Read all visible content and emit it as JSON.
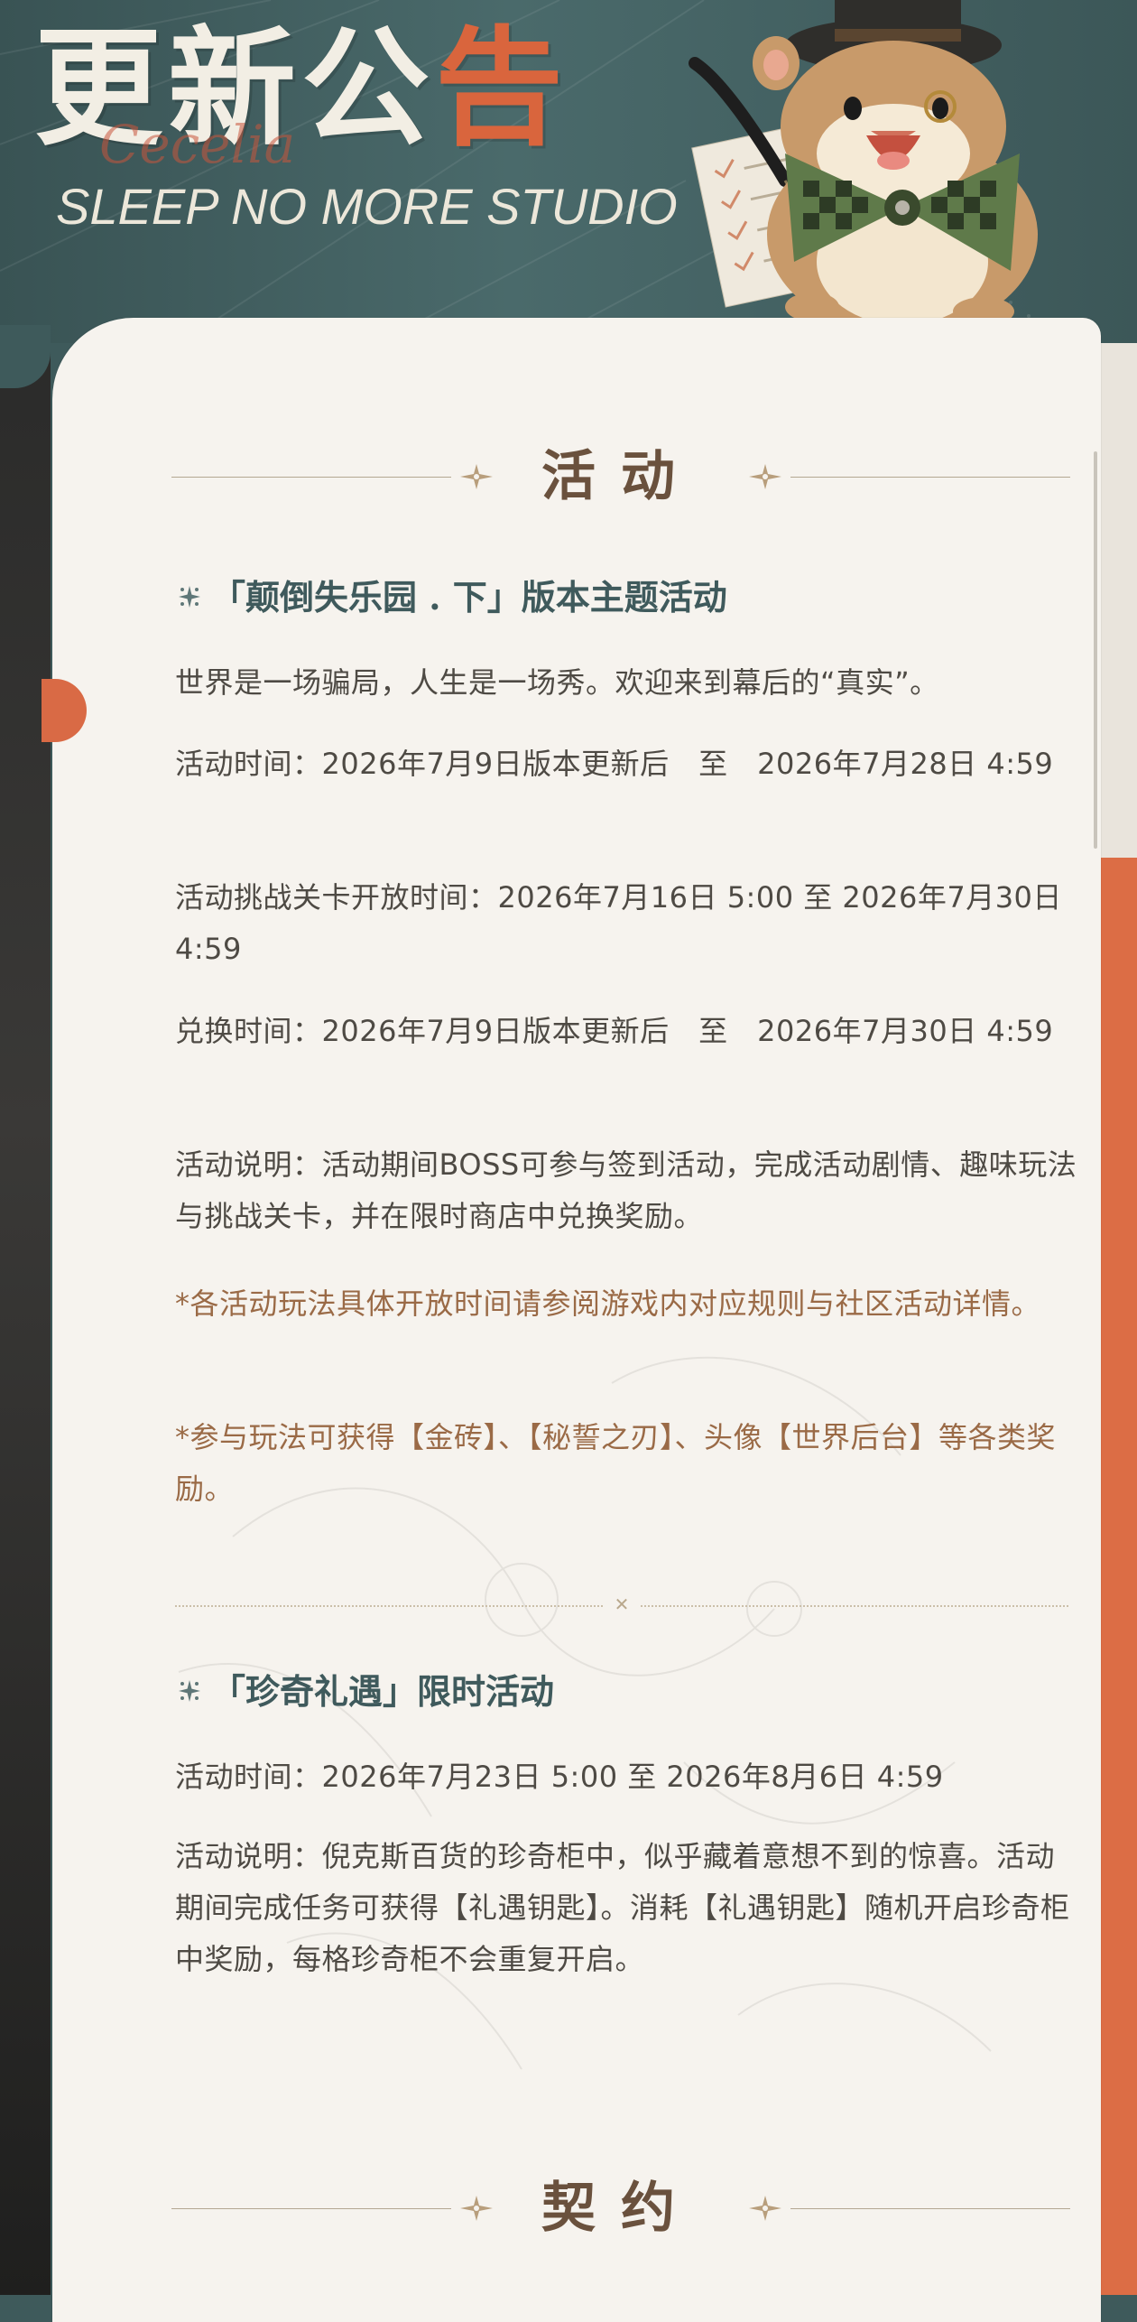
{
  "header": {
    "title_part1": "更新公",
    "title_part2": "告",
    "script_text": "Cecelia",
    "studio": "SLEEP NO MORE STUDIO"
  },
  "colors": {
    "header_bg": "#3e5a5b",
    "accent_orange": "#d9653d",
    "card_bg": "#f6f3ee",
    "heading_brown": "#6a513d",
    "subtitle_teal": "#3f5a5c",
    "body_text": "#4e4a44",
    "note_text": "#9a6a46"
  },
  "sections": {
    "activities": {
      "heading": "活动",
      "event1": {
        "title": "「颠倒失乐园 . 下」版本主题活动",
        "intro": "世界是一场骗局，人生是一场秀。欢迎来到幕后的“真实”。",
        "time": "活动时间：2026年7月9日版本更新后　至　2026年7月28日 4:59",
        "challenge_time": "活动挑战关卡开放时间：2026年7月16日 5:00 至 2026年7月30日 4:59",
        "exchange_time": "兑换时间：2026年7月9日版本更新后　至　2026年7月30日 4:59",
        "description": "活动说明：活动期间BOSS可参与签到活动，完成活动剧情、趣味玩法与挑战关卡，并在限时商店中兑换奖励。",
        "note1": "*各活动玩法具体开放时间请参阅游戏内对应规则与社区活动详情。",
        "note2": "*参与玩法可获得【金砖】、【秘誓之刃】、头像【世界后台】等各类奖励。"
      },
      "event2": {
        "title": "「珍奇礼遇」限时活动",
        "time": "活动时间：2026年7月23日 5:00 至 2026年8月6日 4:59",
        "description": "活动说明：倪克斯百货的珍奇柜中，似乎藏着意想不到的惊喜。活动期间完成任务可获得【礼遇钥匙】。消耗【礼遇钥匙】随机开启珍奇柜中奖励，每格珍奇柜不会重复开启。"
      }
    },
    "contracts": {
      "heading": "契约"
    }
  }
}
